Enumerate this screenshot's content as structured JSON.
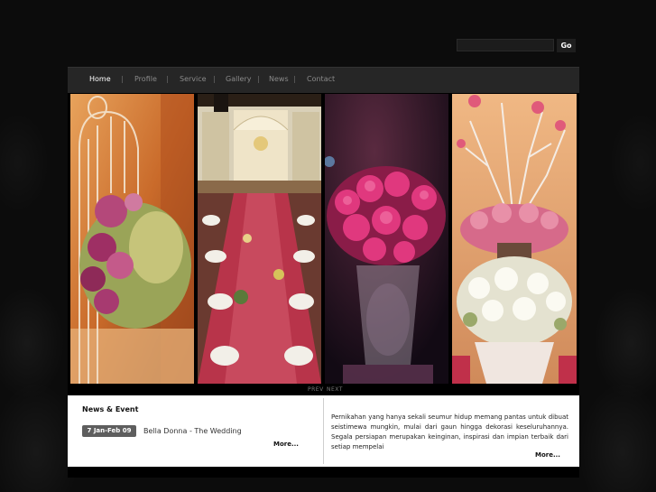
{
  "search": {
    "placeholder": "",
    "button_label": "Go"
  },
  "nav": {
    "items": [
      {
        "label": "Home",
        "active": true
      },
      {
        "label": "Profile",
        "active": false
      },
      {
        "label": "Service",
        "active": false
      },
      {
        "label": "Gallery",
        "active": false
      },
      {
        "label": "News",
        "active": false
      },
      {
        "label": "Contact",
        "active": false
      }
    ],
    "separator": "|"
  },
  "gallery": {
    "photos": [
      {
        "subject": "birdcage-flower-ball"
      },
      {
        "subject": "banquet-hall"
      },
      {
        "subject": "pink-roses"
      },
      {
        "subject": "lily-centerpiece"
      }
    ],
    "prev_label": "PREV",
    "next_label": "NEXT"
  },
  "news": {
    "title": "News & Event",
    "items": [
      {
        "date": "7 Jan-Feb 09",
        "text": "Bella Donna - The Wedding"
      }
    ],
    "more_label": "More..."
  },
  "about": {
    "text": "Pernikahan yang hanya sekali seumur hidup memang pantas untuk dibuat seistimewa mungkin, mulai dari gaun hingga dekorasi keseluruhannya. Segala persiapan merupakan keinginan, inspirasi dan impian terbaik dari setiap mempelai",
    "more_label": "More..."
  },
  "colors": {
    "page_bg": "#0c0c0c",
    "nav_bg": "#262626",
    "badge_bg": "#5e5e5e"
  }
}
